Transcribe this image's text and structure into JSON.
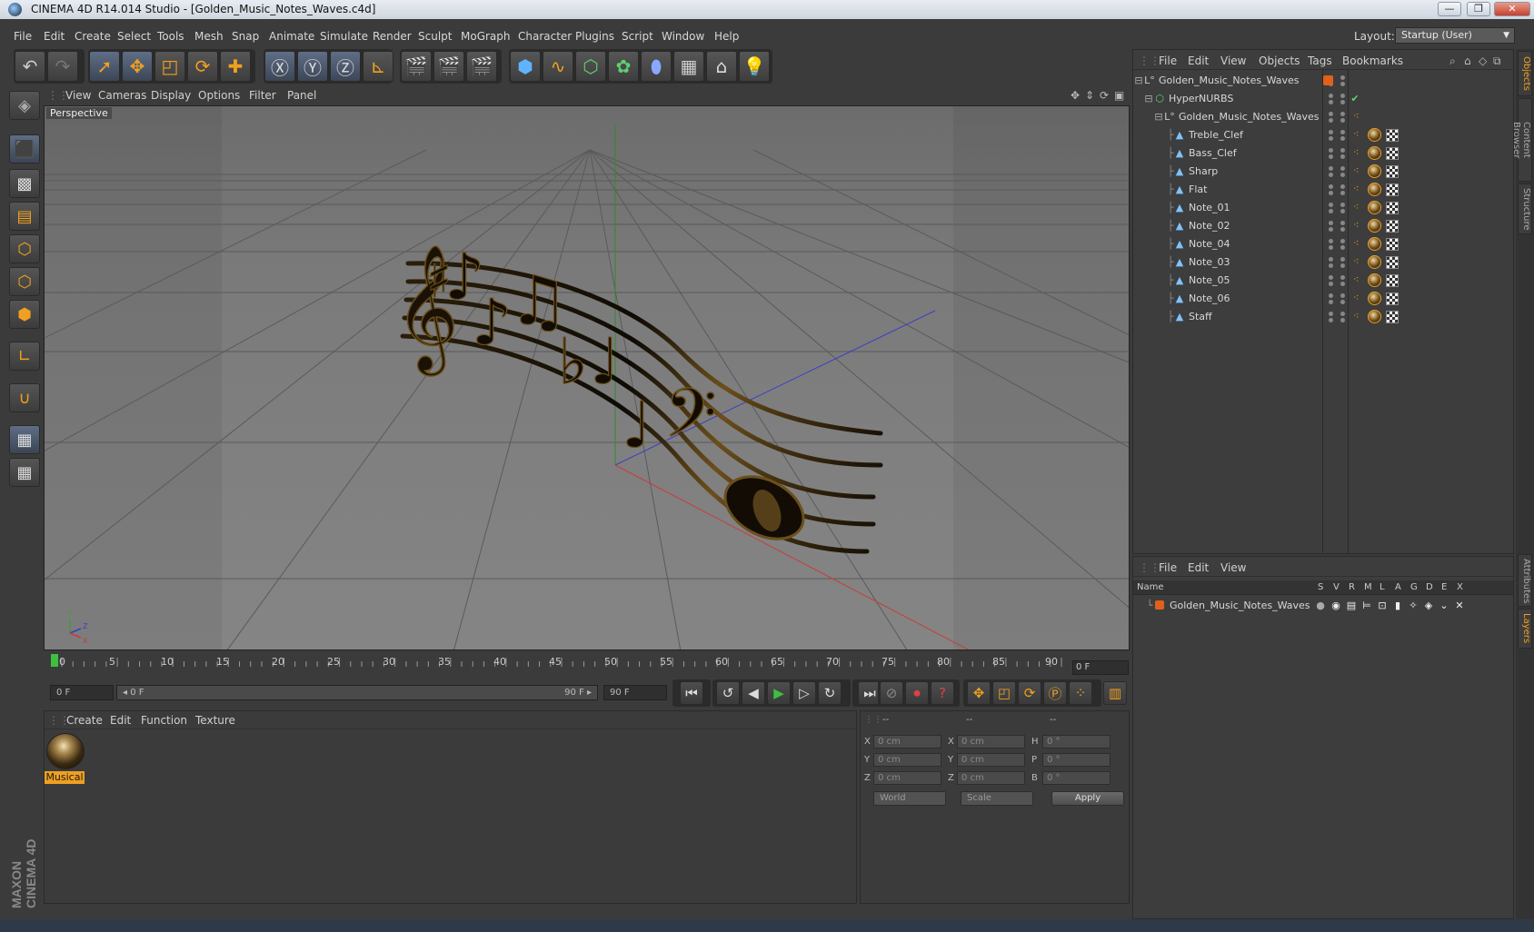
{
  "window": {
    "title": "CINEMA 4D R14.014 Studio - [Golden_Music_Notes_Waves.c4d]",
    "controls": [
      "—",
      "❐",
      "✕"
    ]
  },
  "menubar": {
    "items": [
      "File",
      "Edit",
      "Create",
      "Select",
      "Tools",
      "Mesh",
      "Snap",
      "Animate",
      "Simulate",
      "Render",
      "Sculpt",
      "MoGraph",
      "Character",
      "Plugins",
      "Script",
      "Window",
      "Help"
    ],
    "layout_label": "Layout:",
    "layout_value": "Startup (User)"
  },
  "viewport": {
    "menu": [
      "View",
      "Cameras",
      "Display",
      "Options",
      "Filter",
      "Panel"
    ],
    "camera_label": "Perspective",
    "axis_labels": [
      "Y",
      "Z",
      "X"
    ]
  },
  "timeline": {
    "ticks": [
      "0",
      "5",
      "10",
      "15",
      "20",
      "25",
      "30",
      "35",
      "40",
      "45",
      "50",
      "55",
      "60",
      "65",
      "70",
      "75",
      "80",
      "85",
      "90"
    ],
    "current_frame": "0 F",
    "start_field": "0 F",
    "range_start": "◂ 0 F",
    "range_end": "90 F ▸",
    "end_field": "90 F"
  },
  "material_manager": {
    "menu": [
      "Create",
      "Edit",
      "Function",
      "Texture"
    ],
    "materials": [
      {
        "name": "Musical"
      }
    ]
  },
  "coordinates": {
    "headers": [
      "--",
      "--",
      "--"
    ],
    "rows": [
      {
        "a": "X",
        "av": "0 cm",
        "b": "X",
        "bv": "0 cm",
        "c": "H",
        "cv": "0 °"
      },
      {
        "a": "Y",
        "av": "0 cm",
        "b": "Y",
        "bv": "0 cm",
        "c": "P",
        "cv": "0 °"
      },
      {
        "a": "Z",
        "av": "0 cm",
        "b": "Z",
        "bv": "0 cm",
        "c": "B",
        "cv": "0 °"
      }
    ],
    "mode_world": "World",
    "mode_scale": "Scale",
    "apply_label": "Apply"
  },
  "object_manager": {
    "menu": [
      "File",
      "Edit",
      "View",
      "Objects",
      "Tags",
      "Bookmarks"
    ],
    "objects": [
      {
        "name": "Golden_Music_Notes_Waves",
        "level": 0,
        "icon": "null"
      },
      {
        "name": "HyperNURBS",
        "level": 1,
        "icon": "nurbs"
      },
      {
        "name": "Golden_Music_Notes_Waves",
        "level": 2,
        "icon": "null"
      },
      {
        "name": "Treble_Clef",
        "level": 3,
        "icon": "poly"
      },
      {
        "name": "Bass_Clef",
        "level": 3,
        "icon": "poly"
      },
      {
        "name": "Sharp",
        "level": 3,
        "icon": "poly"
      },
      {
        "name": "Flat",
        "level": 3,
        "icon": "poly"
      },
      {
        "name": "Note_01",
        "level": 3,
        "icon": "poly"
      },
      {
        "name": "Note_02",
        "level": 3,
        "icon": "poly"
      },
      {
        "name": "Note_04",
        "level": 3,
        "icon": "poly"
      },
      {
        "name": "Note_03",
        "level": 3,
        "icon": "poly"
      },
      {
        "name": "Note_05",
        "level": 3,
        "icon": "poly"
      },
      {
        "name": "Note_06",
        "level": 3,
        "icon": "poly"
      },
      {
        "name": "Staff",
        "level": 3,
        "icon": "poly"
      }
    ]
  },
  "layer_manager": {
    "menu": [
      "File",
      "Edit",
      "View"
    ],
    "columns": [
      "Name",
      "S",
      "V",
      "R",
      "M",
      "L",
      "A",
      "G",
      "D",
      "E",
      "X"
    ],
    "layers": [
      {
        "name": "Golden_Music_Notes_Waves",
        "color": "#e0601c"
      }
    ]
  },
  "side_tabs": [
    "Objects",
    "Content Browser",
    "Structure",
    "Attributes",
    "Layers"
  ],
  "branding": "MAXON CINEMA 4D",
  "colors": {
    "accent": "#f0a020",
    "panel": "#3b3b3b",
    "viewport": "#7a7a7a"
  }
}
